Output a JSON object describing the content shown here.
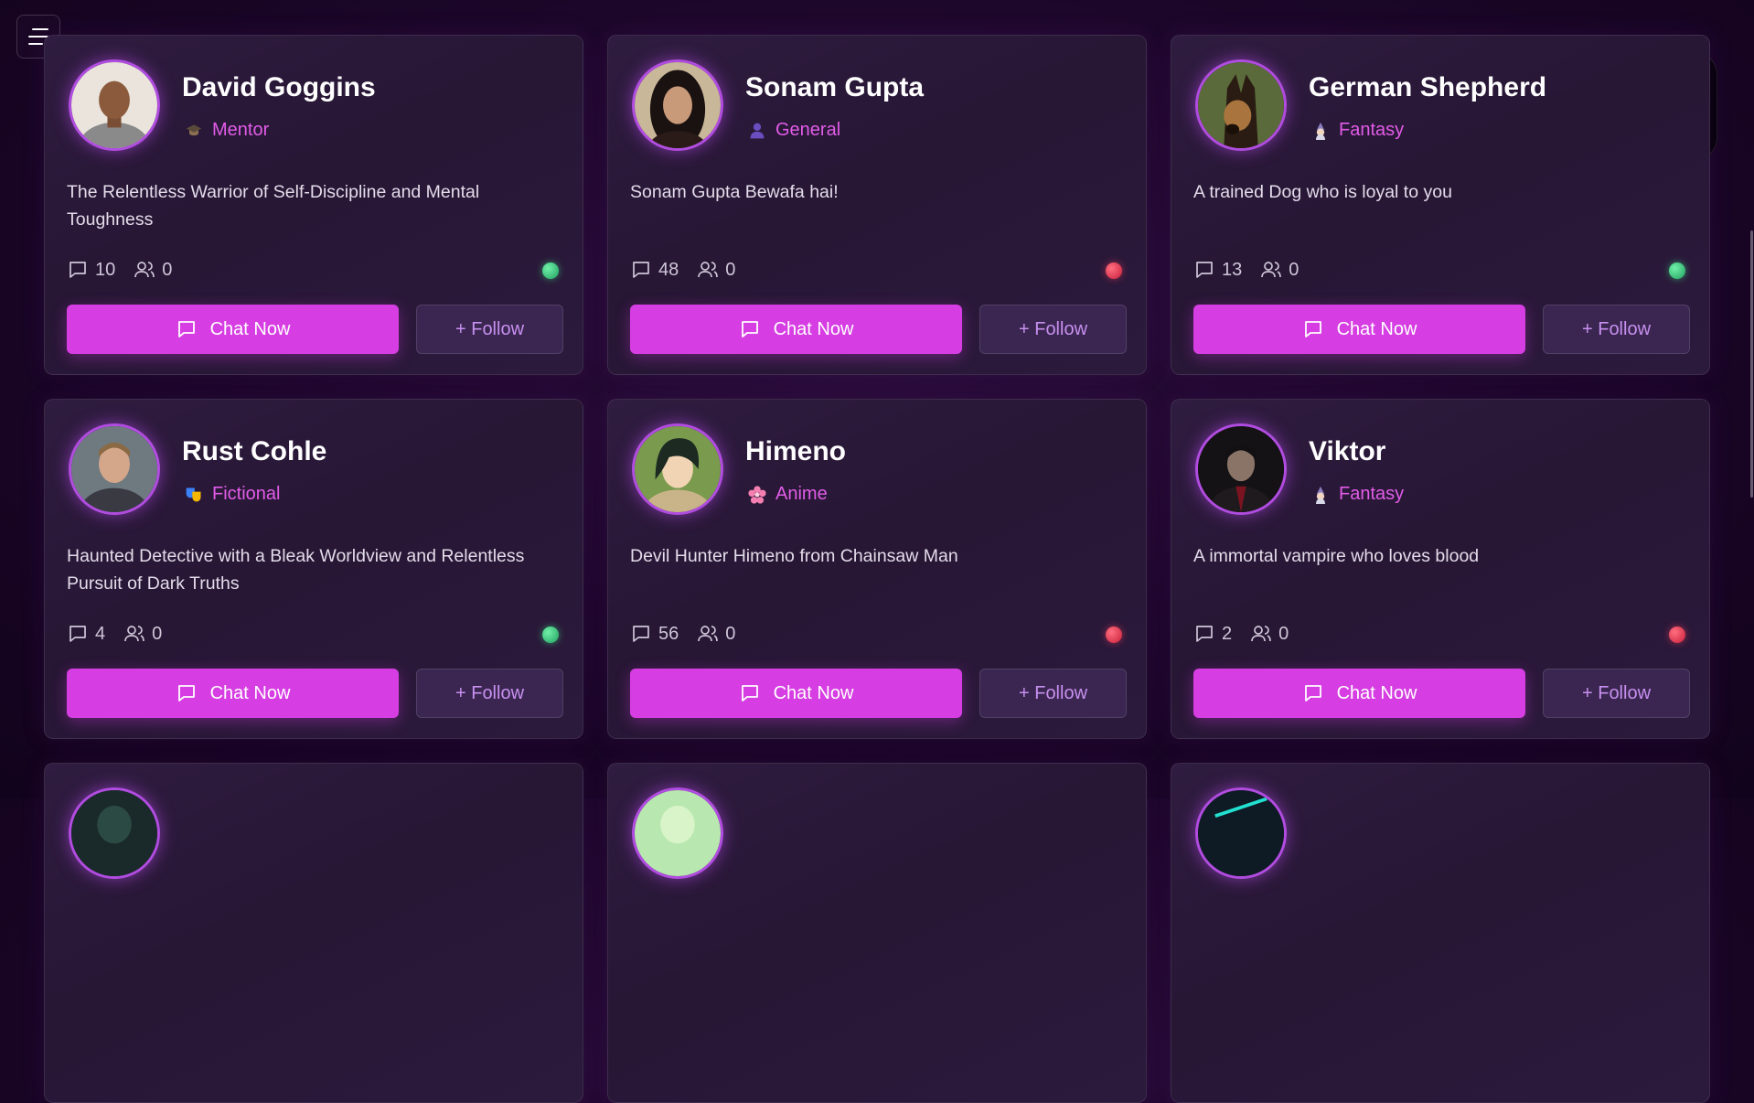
{
  "chat_label": "Chat Now",
  "follow_label": "+ Follow",
  "cards": [
    {
      "name": "David Goggins",
      "category": "Mentor",
      "category_icon": "graduation-cap-icon",
      "description": "The Relentless Warrior of Self-Discipline and Mental Toughness",
      "chats": "10",
      "followers": "0",
      "status": "online"
    },
    {
      "name": "Sonam Gupta",
      "category": "General",
      "category_icon": "person-icon",
      "description": "Sonam Gupta Bewafa hai!",
      "chats": "48",
      "followers": "0",
      "status": "offline"
    },
    {
      "name": "German Shepherd",
      "category": "Fantasy",
      "category_icon": "wizard-icon",
      "description": "A trained Dog who is loyal to you",
      "chats": "13",
      "followers": "0",
      "status": "online"
    },
    {
      "name": "Rust Cohle",
      "category": "Fictional",
      "category_icon": "theater-masks-icon",
      "description": "Haunted Detective with a Bleak Worldview and Relentless Pursuit of Dark Truths",
      "chats": "4",
      "followers": "0",
      "status": "online"
    },
    {
      "name": "Himeno",
      "category": "Anime",
      "category_icon": "cherry-blossom-icon",
      "description": "Devil Hunter Himeno from Chainsaw Man",
      "chats": "56",
      "followers": "0",
      "status": "offline"
    },
    {
      "name": "Viktor",
      "category": "Fantasy",
      "category_icon": "wizard-icon",
      "description": "A immortal vampire who loves blood",
      "chats": "2",
      "followers": "0",
      "status": "offline"
    }
  ],
  "colors": {
    "accent": "#d63de2",
    "online": "#3ccf7f",
    "offline": "#e0334f",
    "category_text": "#e25ce8"
  }
}
